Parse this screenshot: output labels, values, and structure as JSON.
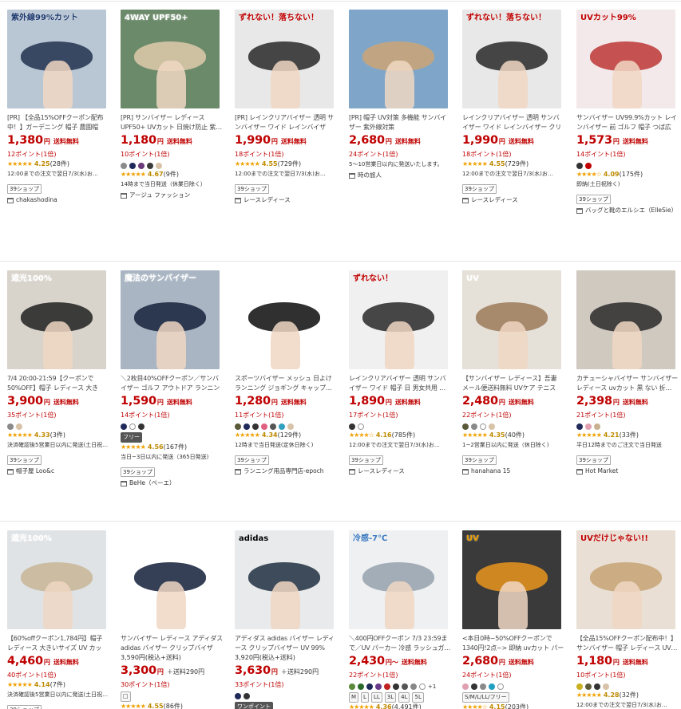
{
  "products": [
    {
      "img": {
        "bg": "#b9c6d4",
        "accent": "#2a3a55",
        "overlay": "紫外線99%カット",
        "ovColor": "#1e3a6e"
      },
      "title": "[PR] 【全品15%OFFクーポン配布中！】ガーデニング 帽子 農園帽 サ…",
      "price": "1,380",
      "yen": "円",
      "ship": "送料無料",
      "points": "12ポイント(1倍)",
      "swatches": [],
      "tags": [],
      "rating": {
        "stars": "★★★★★",
        "value": "4.25",
        "count": "(28件)"
      },
      "delivery": "12:00までの注文で翌日7/3(水)お…",
      "badge": "39ショップ",
      "shop": "chakashodina"
    },
    {
      "img": {
        "bg": "#6b8a6a",
        "accent": "#d8c7a8",
        "overlay": "4WAY UPF50+",
        "ovColor": "#ffffff"
      },
      "title": "[PR] サンバイザー レディース UPF50+ UVカット 日焼け防止 紫…",
      "price": "1,180",
      "yen": "円",
      "ship": "送料無料",
      "points": "10ポイント(1倍)",
      "swatches": [
        "#8a8a8a",
        "#1f2a5a",
        "#6a3a7a",
        "#3a3a3a",
        "#d8c3a8"
      ],
      "tags": [],
      "rating": {
        "stars": "★★★★★",
        "value": "4.67",
        "count": "(9件)"
      },
      "delivery": "14時まで当日発送（休業日除く）",
      "badge": "",
      "shop": "アージュ ファッション"
    },
    {
      "img": {
        "bg": "#e8e8e8",
        "accent": "#333333",
        "overlay": "ずれない！落ちない！",
        "ovColor": "#c00000"
      },
      "title": "[PR] レインクリアバイザー 透明 サンバイザー ワイド レインバイザー…",
      "price": "1,990",
      "yen": "円",
      "ship": "送料無料",
      "points": "18ポイント(1倍)",
      "swatches": [],
      "tags": [],
      "rating": {
        "stars": "★★★★★",
        "value": "4.55",
        "count": "(729件)"
      },
      "delivery": "12:00までの注文で翌日7/3(水)お…",
      "badge": "39ショップ",
      "shop": "レースレディース"
    },
    {
      "img": {
        "bg": "#7fa6c9",
        "accent": "#c9a57a",
        "overlay": "",
        "ovColor": "#fff"
      },
      "title": "[PR] 帽子 UV対策 多機能 サンバイザー 紫外線対策",
      "price": "2,680",
      "yen": "円",
      "ship": "送料無料",
      "points": "24ポイント(1倍)",
      "swatches": [],
      "tags": [],
      "rating": null,
      "delivery": "5～10営業日以内に発送いたします。",
      "badge": "",
      "shop": "時の旅人"
    },
    {
      "img": {
        "bg": "#e8e8e8",
        "accent": "#333333",
        "overlay": "ずれない！落ちない！",
        "ovColor": "#c00000"
      },
      "title": "レインクリアバイザー 透明 サンバイザー ワイド レインバイザー クリア…",
      "price": "1,990",
      "yen": "円",
      "ship": "送料無料",
      "points": "18ポイント(1倍)",
      "swatches": [],
      "tags": [],
      "rating": {
        "stars": "★★★★★",
        "value": "4.55",
        "count": "(729件)"
      },
      "delivery": "12:00までの注文で翌日7/3(水)お…",
      "badge": "39ショップ",
      "shop": "レースレディース"
    },
    {
      "img": {
        "bg": "#f3e9ea",
        "accent": "#c04040",
        "overlay": "UVカット99%",
        "ovColor": "#c00000"
      },
      "title": "サンバイザー UV99.9%カット レインバイザー 前 ゴルフ 帽子 つば広 …",
      "price": "1,573",
      "yen": "円",
      "ship": "送料無料",
      "points": "14ポイント(1倍)",
      "swatches": [
        "#333333",
        "#c00000"
      ],
      "tags": [],
      "rating": {
        "stars": "★★★★☆",
        "value": "4.09",
        "count": "(175件)"
      },
      "delivery": "即納(土日祝除く)",
      "badge": "39ショップ",
      "shop": "バッグと靴のエルシエ（ElleSie）"
    },
    {
      "img": {
        "bg": "#d8d3cb",
        "accent": "#2a2a2a",
        "overlay": "遮光100%",
        "ovColor": "#ffffff"
      },
      "title": "7/4 20:00-21:59【クーポンで50%OFF】帽子 レディース 大きい…",
      "price": "3,900",
      "yen": "円",
      "ship": "送料無料",
      "points": "35ポイント(1倍)",
      "swatches": [
        "#8a8a8a",
        "#d8c3a8"
      ],
      "tags": [],
      "rating": {
        "stars": "★★★★★",
        "value": "4.33",
        "count": "(3件)"
      },
      "delivery": "決済確認後5営業日以内に発送(土日祝…",
      "badge": "39ショップ",
      "shop": "帽子屋 Loo&c"
    },
    {
      "img": {
        "bg": "#a9b5c2",
        "accent": "#1e2a44",
        "overlay": "魔法のサンバイザー",
        "ovColor": "#ffffff"
      },
      "title": "＼2枚目40%OFFクーポン／サンバイザー ゴルフ アウトドア ランニング…",
      "price": "1,590",
      "yen": "円",
      "ship": "送料無料",
      "points": "14ポイント(1倍)",
      "swatches": [
        "#1f2a5a",
        "#ffffff",
        "#333333"
      ],
      "tags": [
        "フリー"
      ],
      "rating": {
        "stars": "★★★★★",
        "value": "4.56",
        "count": "(167件)"
      },
      "delivery": "当日~3日以内に発送（365日発送)",
      "badge": "39ショップ",
      "shop": "BeHe（ベーエ）"
    },
    {
      "img": {
        "bg": "#ffffff",
        "accent": "#1a1a1a",
        "overlay": "",
        "ovColor": "#000"
      },
      "title": "スポーツバイザー メッシュ 日よけ ランニング ジョギング キャップ…",
      "price": "1,280",
      "yen": "円",
      "ship": "送料無料",
      "points": "11ポイント(1倍)",
      "swatches": [
        "#5a5a3a",
        "#1f2a5a",
        "#333333",
        "#e06080",
        "#555555",
        "#30a0c0",
        "#d8c3a8"
      ],
      "tags": [],
      "rating": {
        "stars": "★★★★★",
        "value": "4.34",
        "count": "(129件)"
      },
      "delivery": "12時まで当日発送(定休日除く)",
      "badge": "39ショップ",
      "shop": "ランニング用品専門店-epoch"
    },
    {
      "img": {
        "bg": "#f0f0f0",
        "accent": "#333333",
        "overlay": "ずれない！",
        "ovColor": "#c00000"
      },
      "title": "レインクリアバイザー 透明 サンバイザー ワイド 帽子 日 男女共用 …",
      "price": "1,890",
      "yen": "円",
      "ship": "送料無料",
      "points": "17ポイント(1倍)",
      "swatches": [
        "#333333",
        "#ffffff"
      ],
      "tags": [],
      "rating": {
        "stars": "★★★★☆",
        "value": "4.16",
        "count": "(785件)"
      },
      "delivery": "12:00までの注文で翌日7/3(水)お…",
      "badge": "39ショップ",
      "shop": "レースレディース"
    },
    {
      "img": {
        "bg": "#e5e0d8",
        "accent": "#a08060",
        "overlay": "UV",
        "ovColor": "#ffffff"
      },
      "title": "【サンバイザー レディース】吾妻 メール便送料無料 UVケア テニス ゴ…",
      "price": "2,480",
      "yen": "円",
      "ship": "送料無料",
      "points": "22ポイント(1倍)",
      "swatches": [
        "#5a5a3a",
        "#8a8a8a",
        "#ffffff",
        "#d8c3a8"
      ],
      "tags": [],
      "rating": {
        "stars": "★★★★★",
        "value": "4.35",
        "count": "(40件)"
      },
      "delivery": "1~2営業日以内に発送（休日除く)",
      "badge": "39ショップ",
      "shop": "hanahana 15"
    },
    {
      "img": {
        "bg": "#cfc9c0",
        "accent": "#333333",
        "overlay": "",
        "ovColor": "#000"
      },
      "title": "カチューシャバイザー サンバイザー レディース uvカット 黒 ない 折…",
      "price": "2,398",
      "yen": "円",
      "ship": "送料無料",
      "points": "21ポイント(1倍)",
      "swatches": [
        "#1f2a5a",
        "#e0a0b0",
        "#c8b090"
      ],
      "tags": [],
      "rating": {
        "stars": "★★★★★",
        "value": "4.21",
        "count": "(33件)"
      },
      "delivery": "平日12時までのご注文で当日発送",
      "badge": "39ショップ",
      "shop": "Hot Market"
    },
    {
      "img": {
        "bg": "#dfe3e6",
        "accent": "#c9b79a",
        "overlay": "遮光100%",
        "ovColor": "#ffffff"
      },
      "title": "【60%offクーポン1,784円】帽子 レディース 大きいサイズ UV カット…",
      "price": "4,460",
      "yen": "円",
      "ship": "送料無料",
      "points": "40ポイント(1倍)",
      "swatches": [],
      "tags": [],
      "rating": {
        "stars": "★★★★★",
        "value": "4.14",
        "count": "(7件)"
      },
      "delivery": "決済確認後5営業日以内に発送(土日祝…",
      "badge": "39ショップ",
      "shop": ""
    },
    {
      "img": {
        "bg": "#ffffff",
        "accent": "#1f2a44",
        "overlay": "",
        "ovColor": "#000"
      },
      "title": "サンバイザー レディース アディダス adidas バイザー クリップバイザー…",
      "orig": "3,590円(税込+送料)",
      "price": "3,300",
      "yen": "円",
      "ship": "＋送料290円",
      "shipPlain": true,
      "points": "30ポイント(1倍)",
      "swatches": [],
      "tags": [
        "□"
      ],
      "rating": {
        "stars": "★★★★★",
        "value": "4.55",
        "count": "(86件)"
      },
      "delivery": "",
      "badge": "",
      "shop": ""
    },
    {
      "img": {
        "bg": "#e8eaec",
        "accent": "#2a3a4a",
        "overlay": "adidas",
        "ovColor": "#000000"
      },
      "title": "アディダス adidas バイザー レディース クリップバイザー UV 99%以…",
      "orig": "3,920円(税込+送料)",
      "price": "3,630",
      "yen": "円",
      "ship": "＋送料290円",
      "shipPlain": true,
      "points": "33ポイント(1倍)",
      "swatches": [
        "#1f2a5a",
        "#333333"
      ],
      "tags": [
        "ワンポイント"
      ],
      "rating": null,
      "delivery": "",
      "badge": "",
      "shop": ""
    },
    {
      "img": {
        "bg": "#eef0f2",
        "accent": "#9aa5b0",
        "overlay": "冷感-7℃",
        "ovColor": "#3a7ac0"
      },
      "title": "＼400円OFFクーポン 7/3 23:59まで／UV パーカー 冷感 ラッシュガ…",
      "price": "2,430",
      "yen": "円～",
      "ship": "送料無料",
      "points": "22ポイント(1倍)",
      "swatches": [
        "#5a8a3a",
        "#2a6a2a",
        "#1f2a5a",
        "#6a3a8a",
        "#c02020",
        "#333333",
        "#555555",
        "#888888",
        "#ffffff"
      ],
      "more": "+1",
      "tags": [
        "M",
        "L",
        "LL",
        "3L",
        "4L",
        "5L"
      ],
      "rating": {
        "stars": "★★★★★",
        "value": "4.36",
        "count": "(4,491件)"
      },
      "delivery": "",
      "badge": "",
      "shop": ""
    },
    {
      "img": {
        "bg": "#3a3a3a",
        "accent": "#e09020",
        "overlay": "UV",
        "ovColor": "#f0a000"
      },
      "title": "<本日0時~50%OFFクーポンで1340円!2点~> 即納 uvカット パーカー…",
      "price": "2,680",
      "yen": "円",
      "ship": "送料無料",
      "points": "24ポイント(1倍)",
      "swatches": [
        "#e0a0b0",
        "#333333",
        "#8a8a8a",
        "#20a0c0",
        "#ffffff"
      ],
      "tags": [
        "S/M/L/LL/フリー"
      ],
      "rating": {
        "stars": "★★★★☆",
        "value": "4.15",
        "count": "(203件)"
      },
      "delivery": "",
      "badge": "",
      "shop": ""
    },
    {
      "img": {
        "bg": "#e9dfd5",
        "accent": "#c9a77a",
        "overlay": "UVだけじゃない!!",
        "ovColor": "#c00000"
      },
      "title": "【全品15%OFFクーポン配布中！】サンバイザー 帽子 レディース UV…",
      "price": "1,180",
      "yen": "円",
      "ship": "送料無料",
      "points": "10ポイント(1倍)",
      "swatches": [
        "#c8b020",
        "#5a5a3a",
        "#333333",
        "#d8c3a8"
      ],
      "tags": [],
      "rating": {
        "stars": "★★★★★",
        "value": "4.28",
        "count": "(32件)"
      },
      "delivery": "12:00までの注文で翌日7/3(水)お…",
      "badge": "",
      "shop": ""
    }
  ]
}
